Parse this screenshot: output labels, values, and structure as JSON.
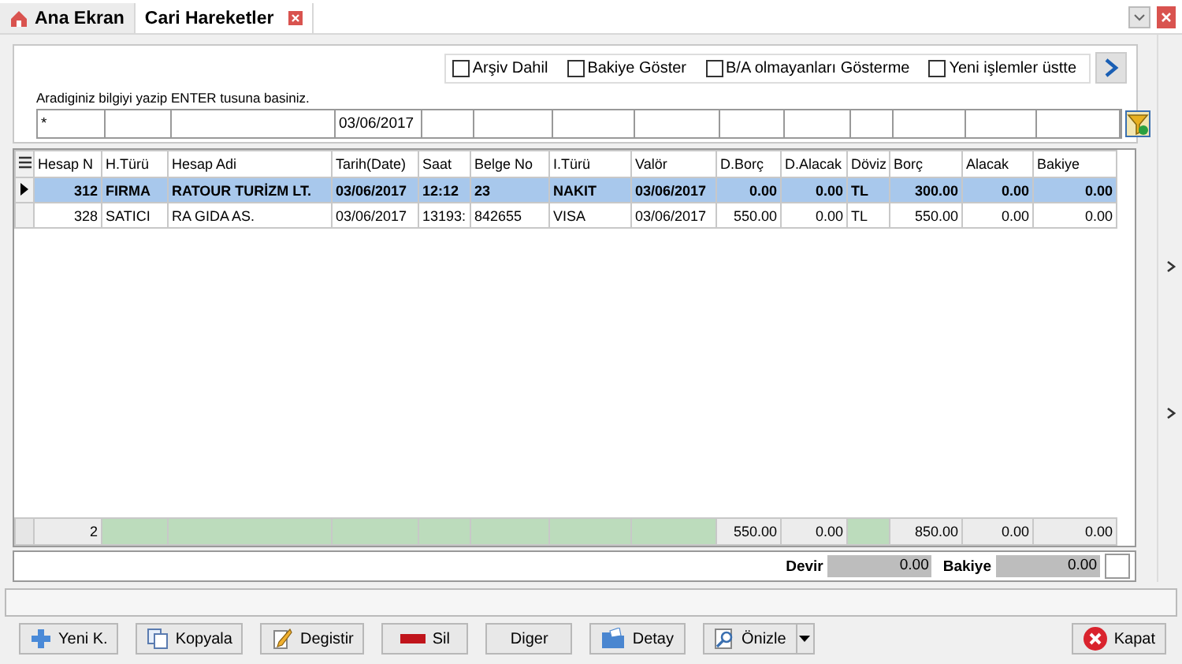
{
  "tabs": [
    {
      "label": "Ana Ekran",
      "kind": "home",
      "selected": false
    },
    {
      "label": "Cari Hareketler",
      "kind": "document",
      "selected": true
    }
  ],
  "options": [
    {
      "label": "Arşiv Dahil",
      "checked": false
    },
    {
      "label": "Bakiye Göster",
      "checked": false
    },
    {
      "label": "B/A olmayanları Gösterme",
      "checked": false
    },
    {
      "label": "Yeni işlemler üstte",
      "checked": false
    }
  ],
  "search_hint": "Aradiginiz bilgiyi yazip ENTER tusuna basiniz.",
  "filters": [
    {
      "kind": "value",
      "value": "*"
    },
    {
      "kind": "blank"
    },
    {
      "kind": "blank"
    },
    {
      "kind": "value",
      "value": "03/06/2017"
    },
    {
      "kind": "blank"
    },
    {
      "kind": "blank"
    },
    {
      "kind": "blank"
    },
    {
      "kind": "blank"
    },
    {
      "kind": "blank"
    },
    {
      "kind": "blank"
    },
    {
      "kind": "blank"
    },
    {
      "kind": "blank"
    },
    {
      "kind": "blank"
    },
    {
      "kind": "blank"
    }
  ],
  "table": {
    "columns": [
      {
        "label": "Hesap N",
        "kind": "number"
      },
      {
        "label": "H.Türü",
        "kind": "text"
      },
      {
        "label": "Hesap Adi",
        "kind": "text"
      },
      {
        "label": "Tarih(Date)",
        "kind": "text"
      },
      {
        "label": "Saat",
        "kind": "text"
      },
      {
        "label": "Belge No",
        "kind": "text"
      },
      {
        "label": "I.Türü",
        "kind": "text"
      },
      {
        "label": "Valör",
        "kind": "text"
      },
      {
        "label": "D.Borç",
        "kind": "number"
      },
      {
        "label": "D.Alacak",
        "kind": "number"
      },
      {
        "label": "Döviz",
        "kind": "text"
      },
      {
        "label": "Borç",
        "kind": "number"
      },
      {
        "label": "Alacak",
        "kind": "number"
      },
      {
        "label": "Bakiye",
        "kind": "number"
      }
    ],
    "rows": [
      {
        "selected": true,
        "cells": [
          "312",
          "FIRMA",
          "RATOUR TURİZM LT.",
          "03/06/2017",
          "12:12",
          "23",
          "NAKIT",
          "03/06/2017",
          "0.00",
          "0.00",
          "TL",
          "300.00",
          "0.00",
          "0.00"
        ]
      },
      {
        "selected": false,
        "cells": [
          "328",
          "SATICI",
          "RA GIDA  AS.",
          "03/06/2017",
          "13193:",
          "842655",
          "VISA",
          "03/06/2017",
          "550.00",
          "0.00",
          "TL",
          "550.00",
          "0.00",
          "0.00"
        ]
      }
    ],
    "footer": [
      {
        "kind": "total",
        "text": "2"
      },
      {
        "kind": "blank"
      },
      {
        "kind": "blank"
      },
      {
        "kind": "blank"
      },
      {
        "kind": "blank"
      },
      {
        "kind": "blank"
      },
      {
        "kind": "blank"
      },
      {
        "kind": "blank"
      },
      {
        "kind": "total",
        "text": "550.00"
      },
      {
        "kind": "total",
        "text": "0.00"
      },
      {
        "kind": "blank"
      },
      {
        "kind": "total",
        "text": "850.00"
      },
      {
        "kind": "total",
        "text": "0.00"
      },
      {
        "kind": "total",
        "text": "0.00"
      }
    ]
  },
  "summary": [
    {
      "label": "Devir",
      "value": "0.00"
    },
    {
      "label": "Bakiye",
      "value": "0.00"
    }
  ],
  "buttons": [
    {
      "label": "Yeni K.",
      "kind": "plus",
      "dropdown": false
    },
    {
      "label": "Kopyala",
      "kind": "copy",
      "dropdown": false
    },
    {
      "label": "Degistir",
      "kind": "pencil",
      "dropdown": false
    },
    {
      "label": "Sil",
      "kind": "minus",
      "dropdown": false
    },
    {
      "label": "Diger",
      "kind": "plain",
      "dropdown": false
    },
    {
      "label": "Detay",
      "kind": "folder",
      "dropdown": false
    },
    {
      "label": "Önizle",
      "kind": "preview",
      "dropdown": true
    }
  ],
  "close_button": {
    "label": "Kapat",
    "kind": "close"
  }
}
